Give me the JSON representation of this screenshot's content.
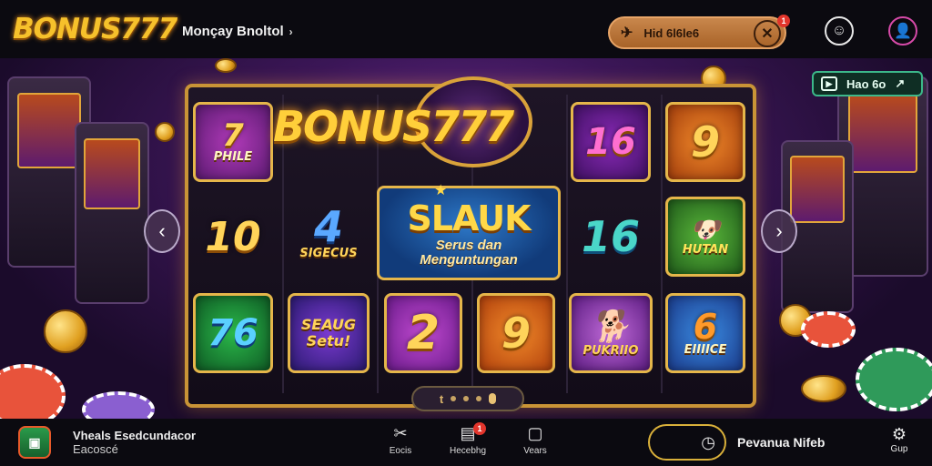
{
  "header": {
    "logo": "BONUS777",
    "nav_link": "Monçay Bnoltol",
    "nav_chevron": "›",
    "promo_label": "Hid 6l6le6",
    "promo_badge": "1"
  },
  "topbar_icons": {
    "emoji_icon": "smile-icon",
    "profile_icon": "user-icon"
  },
  "demo_button": {
    "label": "Hao 6o"
  },
  "slot": {
    "banner_logo": "BONUS777",
    "feature_title": "SLAUK",
    "feature_sub1": "Serus dan",
    "feature_sub2": "Menguntungan",
    "tiles": {
      "r1c1": "PHILE",
      "r1c1_num": "7",
      "r1c4": "16",
      "r1c5": "9",
      "r2c1": "10",
      "r2c2_num": "4",
      "r2c2_label": "SIGECUS",
      "r2c4": "16",
      "r2c5": "HUTAN",
      "r3c1": "76",
      "r3c2": "SEAUG Setu!",
      "r3c3": "2",
      "r3c4": "9",
      "r3c5": "PUKRIIO",
      "r3c6_num": "6",
      "r3c6_label": "EIIIICE"
    },
    "pager_symbol": "t"
  },
  "bottom": {
    "app_title": "Vheals Esedcundacor",
    "app_sub": "Eacoscé",
    "nav": [
      {
        "icon": "tools-icon",
        "label": "Eocis"
      },
      {
        "icon": "game-icon",
        "label": "Hecebhg",
        "badge": "1"
      },
      {
        "icon": "chat-icon",
        "label": "Vears"
      }
    ],
    "cta_label": "Pevanua Nifeb",
    "settings_label": "Gup"
  },
  "colors": {
    "accent_gold": "#e5b64a",
    "promo_orange": "#c9874c",
    "demo_green": "#3cb88a",
    "badge_red": "#e2352c"
  }
}
